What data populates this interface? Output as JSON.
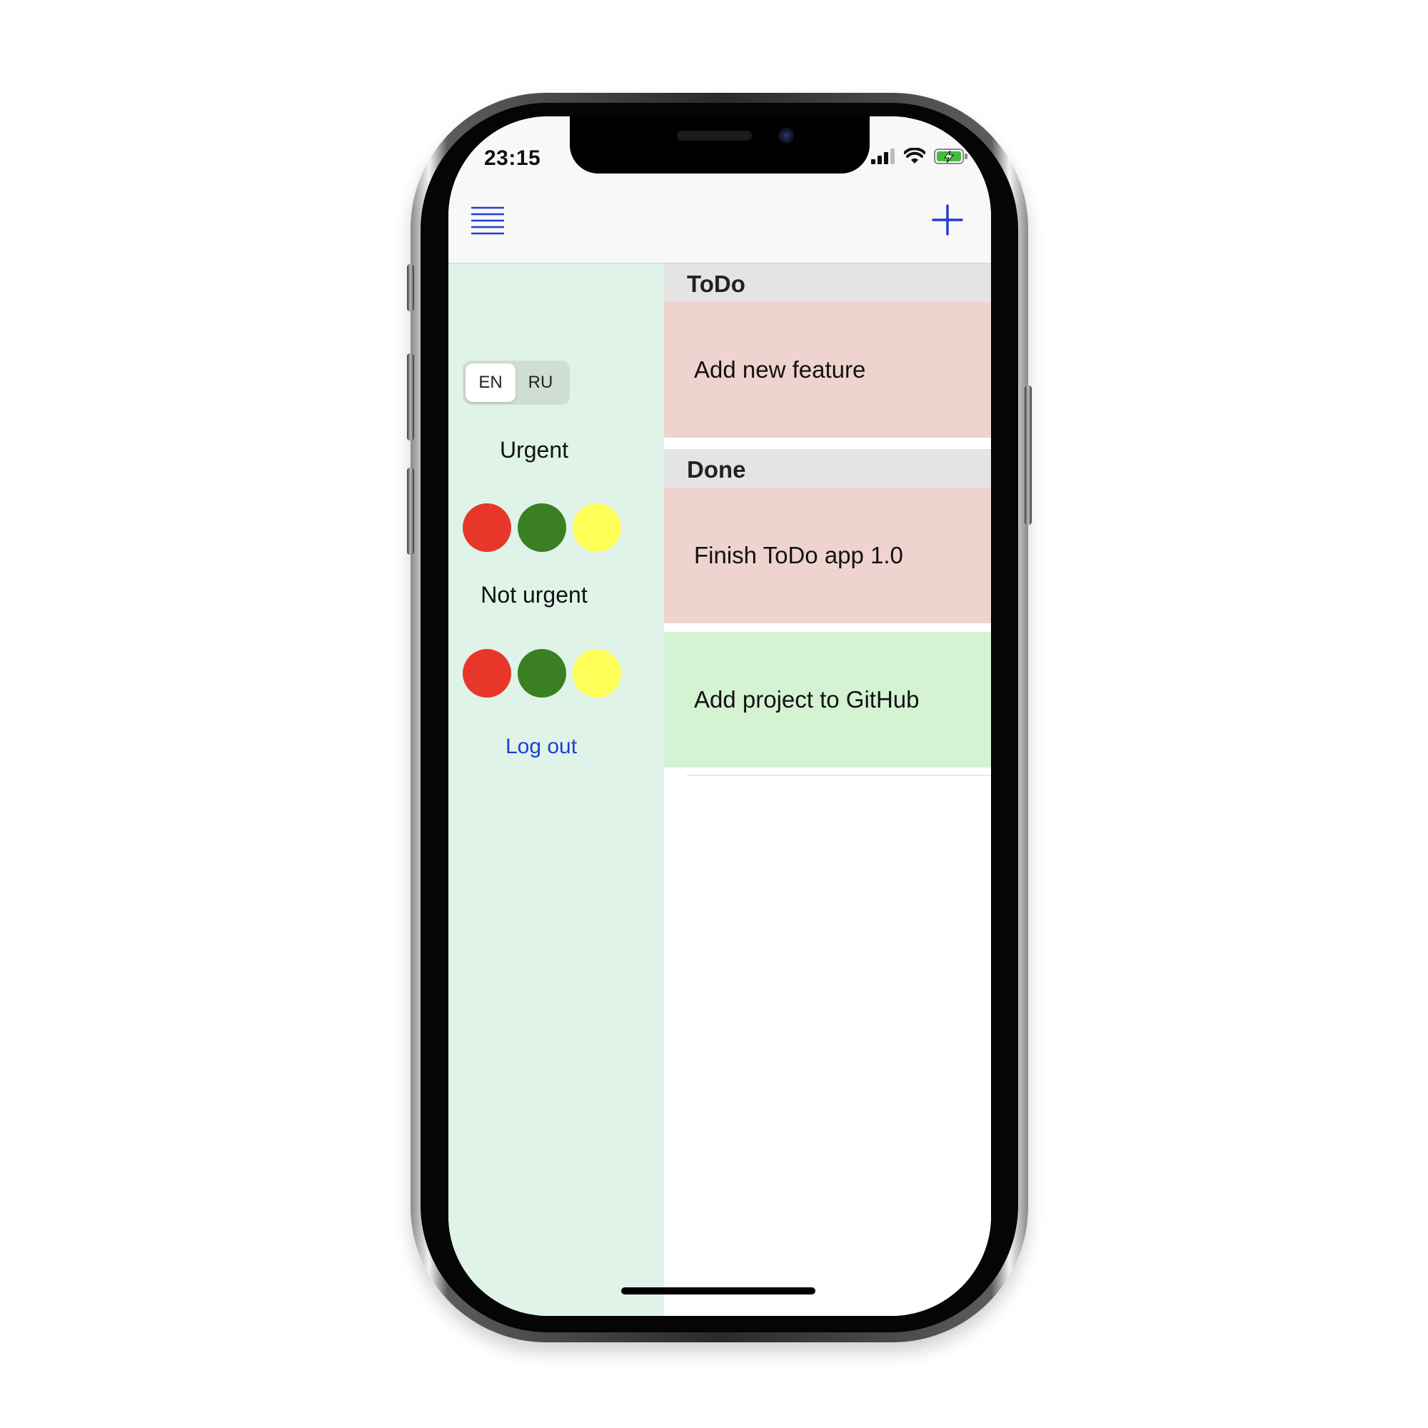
{
  "status_bar": {
    "time": "23:15"
  },
  "nav_bar": {
    "menu_icon": "hamburger-icon",
    "add_icon": "plus-icon",
    "accent_color": "#1f3fd1"
  },
  "sidebar": {
    "language": {
      "options": [
        "EN",
        "RU"
      ],
      "selected": "EN"
    },
    "urgent_label": "Urgent",
    "not_urgent_label": "Not urgent",
    "priority_colors": [
      "#e8372a",
      "#3a7f22",
      "#fefe58"
    ],
    "logout_label": "Log out",
    "background": "#e0f3e8"
  },
  "sections": [
    {
      "title": "ToDo",
      "items": [
        {
          "text": "Add new feature",
          "color": "#efd3cf"
        }
      ]
    },
    {
      "title": "Done",
      "items": [
        {
          "text": "Finish ToDo app 1.0",
          "color": "#efd3cf"
        },
        {
          "text": "Add project to GitHub",
          "color": "#d4f3d3"
        }
      ]
    }
  ]
}
